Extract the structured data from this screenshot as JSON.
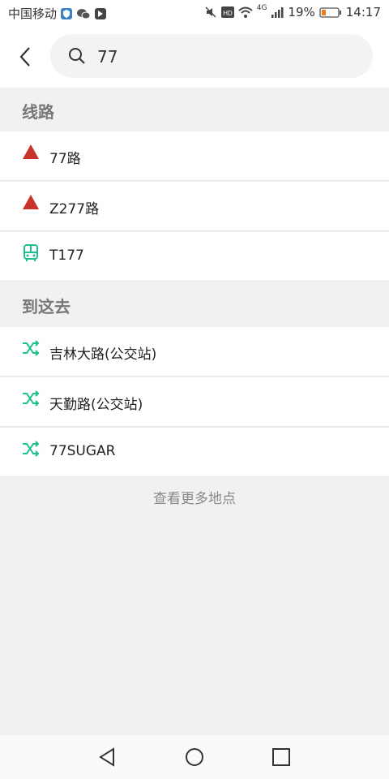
{
  "status_bar": {
    "carrier": "中国移动",
    "network": "4G",
    "battery": "19%",
    "time": "14:17",
    "icons": [
      "shield-icon",
      "wechat-icon",
      "app-icon",
      "mute-icon",
      "hd-icon",
      "wifi-icon",
      "signal-icon",
      "battery-icon"
    ]
  },
  "search": {
    "query": "77",
    "icon": "search-icon",
    "back_icon": "back-arrow-icon"
  },
  "sections": {
    "routes_title": "线路",
    "routes": [
      {
        "label": "77路",
        "icon": "route-triangle-icon",
        "color": "#c8332b"
      },
      {
        "label": "Z277路",
        "icon": "route-triangle-icon",
        "color": "#c8332b"
      },
      {
        "label": "T177",
        "icon": "bus-icon",
        "color": "#1fbf8f"
      }
    ],
    "places_title": "到这去",
    "places": [
      {
        "label": "吉林大路(公交站)",
        "icon": "shuffle-icon",
        "color": "#1fbf8f"
      },
      {
        "label": "天勤路(公交站)",
        "icon": "shuffle-icon",
        "color": "#1fbf8f"
      },
      {
        "label": "77SUGAR",
        "icon": "shuffle-icon",
        "color": "#1fbf8f"
      }
    ]
  },
  "more_link": "查看更多地点",
  "nav": {
    "back": "nav-back-icon",
    "home": "nav-home-icon",
    "recent": "nav-recent-icon"
  }
}
